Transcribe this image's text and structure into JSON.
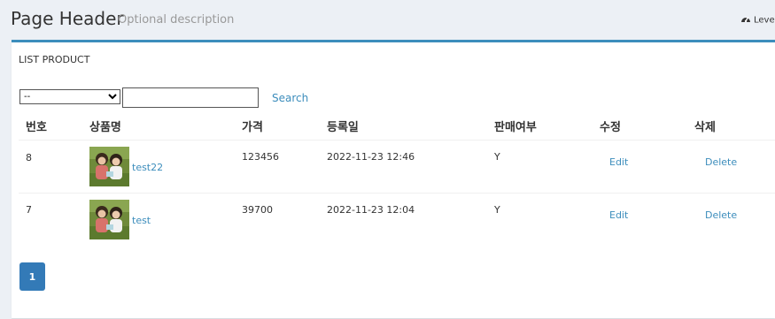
{
  "header": {
    "title": "Page Header",
    "description": "Optional description",
    "breadcrumb": "Leve"
  },
  "box": {
    "title": "LIST PRODUCT"
  },
  "search": {
    "selected_option": "--",
    "input_value": "",
    "button_label": "Search"
  },
  "table": {
    "headers": [
      "번호",
      "상품명",
      "가격",
      "등록일",
      "판매여부",
      "수정",
      "삭제"
    ],
    "rows": [
      {
        "no": "8",
        "name": "test22",
        "price": "123456",
        "date": "2022-11-23 12:46",
        "on_sale": "Y",
        "edit": "Edit",
        "delete": "Delete"
      },
      {
        "no": "7",
        "name": "test",
        "price": "39700",
        "date": "2022-11-23 12:04",
        "on_sale": "Y",
        "edit": "Edit",
        "delete": "Delete"
      }
    ]
  },
  "pagination": {
    "current": "1"
  },
  "colors": {
    "accent": "#3c8dbc",
    "page_button": "#337ab7",
    "background": "#ecf0f5"
  }
}
